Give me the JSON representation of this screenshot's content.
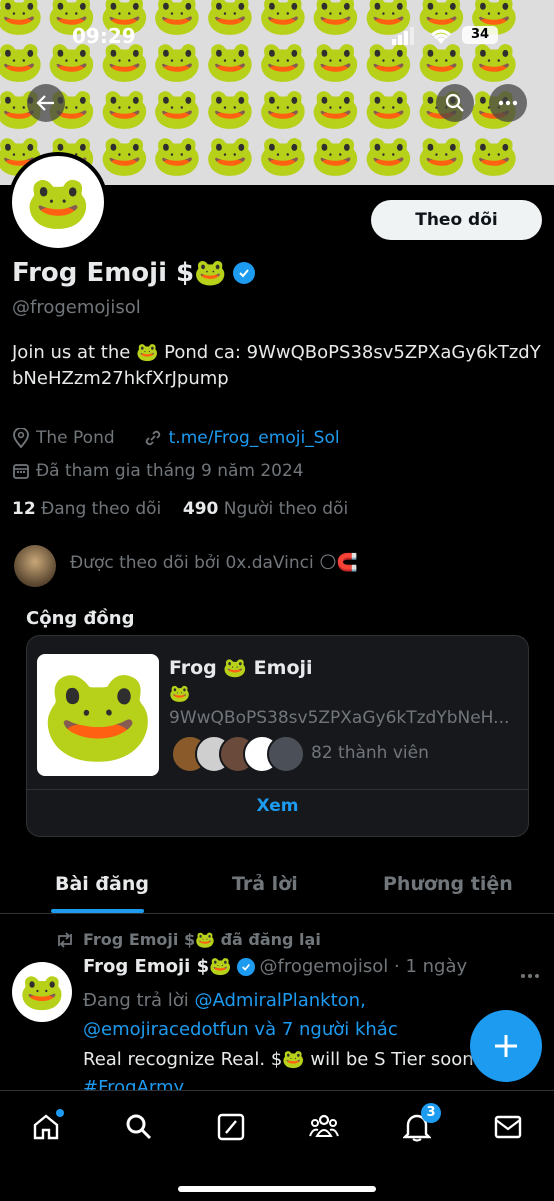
{
  "status_bar": {
    "time": "09:29",
    "battery": "34"
  },
  "banner": {
    "pattern_emoji": "🐸"
  },
  "profile": {
    "avatar_emoji": "🐸",
    "follow_label": "Theo dõi",
    "name": "Frog Emoji $🐸",
    "handle": "@frogemojisol",
    "bio": "Join us at the 🐸 Pond ca: 9WwQBoPS38sv5ZPXaGy6kTzdYbNeHZzm27hkfXrJpump",
    "location": "The Pond",
    "website": "t.me/Frog_emoji_Sol",
    "joined": "Đã tham gia tháng 9 năm 2024",
    "following_count": "12",
    "following_label": "Đang theo dõi",
    "followers_count": "490",
    "followers_label": "Người theo dõi",
    "followed_by": "Được theo dõi bởi 0x.daVinci 🌕🧲"
  },
  "community": {
    "section_title": "Cộng đồng",
    "name": "Frog 🐸 Emoji",
    "emoji_line": "🐸",
    "description": "9WwQBoPS38sv5ZPXaGy6kTzdYbNeH...",
    "members": "82 thành viên",
    "view_label": "Xem",
    "image_emoji": "🐸"
  },
  "tabs": [
    {
      "label": "Bài đăng",
      "active": true
    },
    {
      "label": "Trả lời",
      "active": false
    },
    {
      "label": "Phương tiện",
      "active": false
    }
  ],
  "post": {
    "repost_text": "Frog Emoji $🐸 đã đăng lại",
    "author": "Frog Emoji $🐸",
    "handle_time": "@frogemojisol · 1 ngày",
    "replying_prefix": "Đang trả lời",
    "reply_to_1": "@AdmiralPlankton,",
    "reply_to_2": "@emojiracedotfun",
    "reply_suffix": "và 7 người khác",
    "body": "Real recognize Real. $🐸 will be S Tier soon.",
    "hashtag": "#FrogArmy"
  },
  "nav": {
    "notification_badge": "3"
  },
  "colors": {
    "accent": "#1d9bf0",
    "background": "#000000",
    "muted": "#71767b"
  }
}
